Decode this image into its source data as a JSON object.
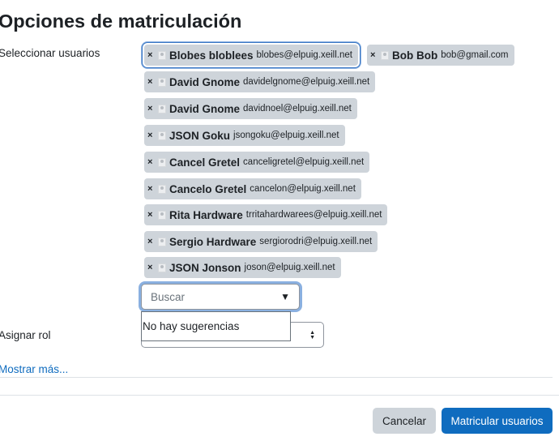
{
  "dialog": {
    "title": "Opciones de matriculación"
  },
  "users_field": {
    "label": "Seleccionar usuarios",
    "remove_glyph": "×",
    "selected": [
      {
        "name": "Blobes bloblees",
        "email": "blobes@elpuig.xeill.net",
        "focused": true
      },
      {
        "name": "Bob Bob",
        "email": "bob@gmail.com"
      },
      {
        "name": "David Gnome",
        "email": "davidelgnome@elpuig.xeill.net"
      },
      {
        "name": "David Gnome",
        "email": "davidnoel@elpuig.xeill.net"
      },
      {
        "name": "JSON Goku",
        "email": "jsongoku@elpuig.xeill.net"
      },
      {
        "name": "Cancel Gretel",
        "email": "canceligretel@elpuig.xeill.net"
      },
      {
        "name": "Cancelo Gretel",
        "email": "cancelon@elpuig.xeill.net"
      },
      {
        "name": "Rita Hardware",
        "email": "trritahardwarees@elpuig.xeill.net"
      },
      {
        "name": "Sergio Hardware",
        "email": "sergiorodri@elpuig.xeill.net"
      },
      {
        "name": "JSON Jonson",
        "email": "joson@elpuig.xeill.net"
      }
    ],
    "search_placeholder": "Buscar",
    "dropdown_arrow": "▼",
    "suggestions_text": "No hay sugerencias"
  },
  "role_field": {
    "label": "Asignar rol",
    "value": ""
  },
  "show_more": "Mostrar más...",
  "footer": {
    "cancel_label": "Cancelar",
    "enrol_label": "Matricular usuarios"
  },
  "colors": {
    "primary": "#0f6cbf",
    "chip_bg": "#ced4da",
    "focus_ring": "#8ab0e0"
  }
}
